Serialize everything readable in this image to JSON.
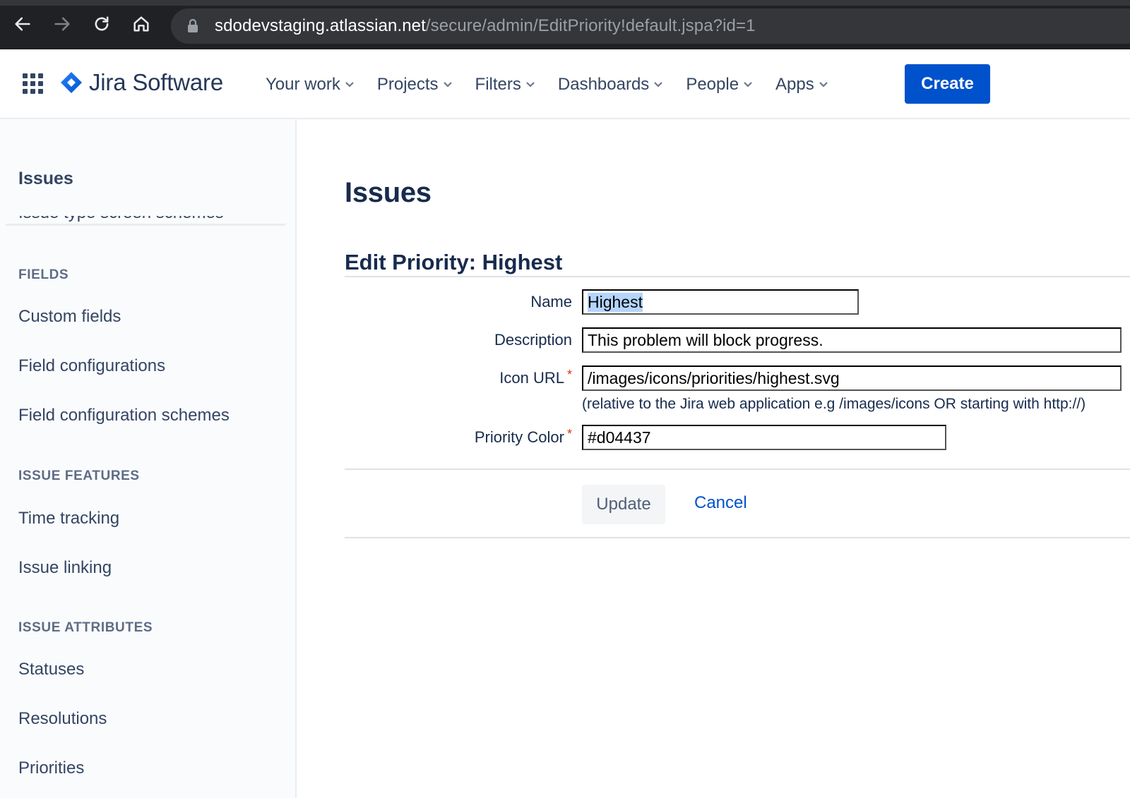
{
  "browser": {
    "url_host": "sdodevstaging.atlassian.net",
    "url_path": "/secure/admin/EditPriority!default.jspa?id=1"
  },
  "header": {
    "product_name": "Jira Software",
    "nav": [
      "Your work",
      "Projects",
      "Filters",
      "Dashboards",
      "People",
      "Apps"
    ],
    "create_label": "Create"
  },
  "sidebar": {
    "title": "Issues",
    "partial_item": "Issue type screen schemes",
    "groups": {
      "fields": "FIELDS",
      "issue_features": "ISSUE FEATURES",
      "issue_attributes": "ISSUE ATTRIBUTES"
    },
    "items": {
      "custom_fields": "Custom fields",
      "field_configurations": "Field configurations",
      "field_configuration_schemes": "Field configuration schemes",
      "time_tracking": "Time tracking",
      "issue_linking": "Issue linking",
      "statuses": "Statuses",
      "resolutions": "Resolutions",
      "priorities": "Priorities"
    }
  },
  "main": {
    "page_title": "Issues",
    "form_title": "Edit Priority: Highest",
    "fields": {
      "name_label": "Name",
      "name_value": "Highest",
      "description_label": "Description",
      "description_value": "This problem will block progress.",
      "icon_url_label": "Icon URL",
      "icon_url_value": "/images/icons/priorities/highest.svg",
      "icon_url_hint": "(relative to the Jira web application e.g /images/icons OR starting with http://)",
      "priority_color_label": "Priority Color",
      "priority_color_value": "#d04437",
      "required_mark": "*"
    },
    "update_label": "Update",
    "cancel_label": "Cancel"
  },
  "colors": {
    "brand": "#0052cc",
    "browser_bg": "#202124",
    "required": "#de350b",
    "selection": "#b4d5fe"
  }
}
